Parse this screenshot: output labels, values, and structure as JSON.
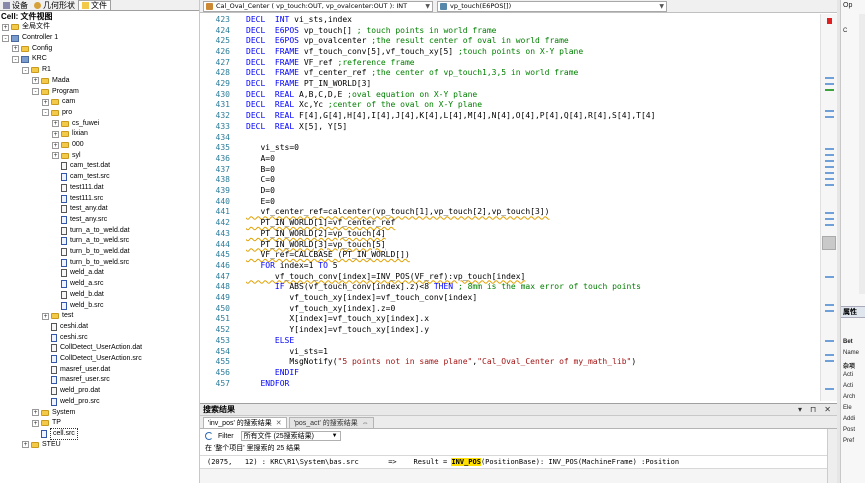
{
  "left_panel": {
    "tabs": [
      {
        "label": "设备",
        "icon": "device-icon"
      },
      {
        "label": "几何形状",
        "icon": "geometry-icon"
      },
      {
        "label": "文件",
        "icon": "file-icon"
      }
    ],
    "title": "Cell: 文件视图",
    "tree": [
      {
        "label": "全局文件",
        "depth": 0,
        "kind": "folder",
        "exp": "+"
      },
      {
        "label": "Controller 1",
        "depth": 0,
        "kind": "cfg",
        "exp": "-"
      },
      {
        "label": "Config",
        "depth": 1,
        "kind": "folder",
        "exp": "+"
      },
      {
        "label": "KRC",
        "depth": 1,
        "kind": "cfg",
        "exp": "-"
      },
      {
        "label": "R1",
        "depth": 2,
        "kind": "folder",
        "exp": "-"
      },
      {
        "label": "Mada",
        "depth": 3,
        "kind": "folder",
        "exp": "+"
      },
      {
        "label": "Program",
        "depth": 3,
        "kind": "folder",
        "exp": "-"
      },
      {
        "label": "cam",
        "depth": 4,
        "kind": "folder",
        "exp": "+"
      },
      {
        "label": "pro",
        "depth": 4,
        "kind": "folder",
        "exp": "-"
      },
      {
        "label": "cs_fuwei",
        "depth": 5,
        "kind": "folder",
        "exp": "+"
      },
      {
        "label": "lixian",
        "depth": 5,
        "kind": "folder",
        "exp": "+"
      },
      {
        "label": "000",
        "depth": 5,
        "kind": "folder",
        "exp": "+"
      },
      {
        "label": "syl",
        "depth": 5,
        "kind": "folder",
        "exp": "+"
      },
      {
        "label": "cam_test.dat",
        "depth": 5,
        "kind": "dat",
        "exp": ""
      },
      {
        "label": "cam_test.src",
        "depth": 5,
        "kind": "src",
        "exp": ""
      },
      {
        "label": "test111.dat",
        "depth": 5,
        "kind": "dat",
        "exp": ""
      },
      {
        "label": "test111.src",
        "depth": 5,
        "kind": "src",
        "exp": ""
      },
      {
        "label": "test_any.dat",
        "depth": 5,
        "kind": "dat",
        "exp": ""
      },
      {
        "label": "test_any.src",
        "depth": 5,
        "kind": "src",
        "exp": ""
      },
      {
        "label": "turn_a_to_weld.dat",
        "depth": 5,
        "kind": "dat",
        "exp": ""
      },
      {
        "label": "turn_a_to_weld.src",
        "depth": 5,
        "kind": "src",
        "exp": ""
      },
      {
        "label": "turn_b_to_weld.dat",
        "depth": 5,
        "kind": "dat",
        "exp": ""
      },
      {
        "label": "turn_b_to_weld.src",
        "depth": 5,
        "kind": "src",
        "exp": ""
      },
      {
        "label": "weld_a.dat",
        "depth": 5,
        "kind": "dat",
        "exp": ""
      },
      {
        "label": "weld_a.src",
        "depth": 5,
        "kind": "src",
        "exp": ""
      },
      {
        "label": "weld_b.dat",
        "depth": 5,
        "kind": "dat",
        "exp": ""
      },
      {
        "label": "weld_b.src",
        "depth": 5,
        "kind": "src",
        "exp": ""
      },
      {
        "label": "test",
        "depth": 4,
        "kind": "folder",
        "exp": "+"
      },
      {
        "label": "ceshi.dat",
        "depth": 4,
        "kind": "dat",
        "exp": ""
      },
      {
        "label": "ceshi.src",
        "depth": 4,
        "kind": "src",
        "exp": ""
      },
      {
        "label": "CollDetect_UserAction.dat",
        "depth": 4,
        "kind": "dat",
        "exp": ""
      },
      {
        "label": "CollDetect_UserAction.src",
        "depth": 4,
        "kind": "src",
        "exp": ""
      },
      {
        "label": "masref_user.dat",
        "depth": 4,
        "kind": "dat",
        "exp": ""
      },
      {
        "label": "masref_user.src",
        "depth": 4,
        "kind": "src",
        "exp": ""
      },
      {
        "label": "weld_pro.dat",
        "depth": 4,
        "kind": "dat",
        "exp": ""
      },
      {
        "label": "weld_pro.src",
        "depth": 4,
        "kind": "src",
        "exp": ""
      },
      {
        "label": "System",
        "depth": 3,
        "kind": "folder",
        "exp": "+"
      },
      {
        "label": "TP",
        "depth": 3,
        "kind": "folder",
        "exp": "+"
      },
      {
        "label": "cell.src",
        "depth": 3,
        "kind": "src",
        "exp": "",
        "selected": true
      },
      {
        "label": "STEU",
        "depth": 2,
        "kind": "folder",
        "exp": "+"
      }
    ]
  },
  "editor": {
    "combo_left": "Cal_Oval_Center ( vp_touch:OUT, vp_ovalcenter:OUT ): INT",
    "combo_right": "vp_touch(E6POS[])",
    "lines": [
      {
        "n": "423",
        "t": "DECL  INT vi_sts,index"
      },
      {
        "n": "424",
        "t": "DECL  E6POS vp_touch[] ; touch points in world frame"
      },
      {
        "n": "425",
        "t": "DECL  E6POS vp_ovalcenter ;the result center of oval in world frame"
      },
      {
        "n": "426",
        "t": "DECL  FRAME vf_touch_conv[5],vf_touch_xy[5] ;touch points on X-Y plane"
      },
      {
        "n": "427",
        "t": "DECL  FRAME VF_ref ;reference frame"
      },
      {
        "n": "428",
        "t": "DECL  FRAME vf_center_ref ;the center of vp_touch1,3,5 in world frame"
      },
      {
        "n": "429",
        "t": "DECL  FRAME PT_IN_WORLD[3]"
      },
      {
        "n": "430",
        "t": "DECL  REAL A,B,C,D,E ;oval equation on X-Y plane"
      },
      {
        "n": "431",
        "t": "DECL  REAL Xc,Yc ;center of the oval on X-Y plane"
      },
      {
        "n": "432",
        "t": "DECL  REAL F[4],G[4],H[4],I[4],J[4],K[4],L[4],M[4],N[4],O[4],P[4],Q[4],R[4],S[4],T[4]"
      },
      {
        "n": "433",
        "t": "DECL  REAL X[5], Y[5]"
      },
      {
        "n": "434",
        "t": ""
      },
      {
        "n": "435",
        "t": "   vi_sts=0"
      },
      {
        "n": "436",
        "t": "   A=0"
      },
      {
        "n": "437",
        "t": "   B=0"
      },
      {
        "n": "438",
        "t": "   C=0"
      },
      {
        "n": "439",
        "t": "   D=0"
      },
      {
        "n": "440",
        "t": "   E=0"
      },
      {
        "n": "441",
        "t": "   vf_center_ref=calcenter(vp_touch[1],vp_touch[2],vp_touch[3])"
      },
      {
        "n": "442",
        "t": "   PT_IN_WORLD[1]=vf_center_ref"
      },
      {
        "n": "443",
        "t": "   PT_IN_WORLD[2]=vp_touch[4]"
      },
      {
        "n": "444",
        "t": "   PT_IN_WORLD[3]=vp_touch[5]"
      },
      {
        "n": "445",
        "t": "   VF_ref=CALCBASE (PT_IN_WORLD[])"
      },
      {
        "n": "446",
        "t": "   FOR index=1 TO 5"
      },
      {
        "n": "447",
        "t": "      vf_touch_conv[index]=INV_POS(VF_ref):vp_touch[index]"
      },
      {
        "n": "448",
        "t": "      IF ABS(vf_touch_conv[index].z)<8 THEN ; 8mm is the max error of touch points"
      },
      {
        "n": "449",
        "t": "         vf_touch_xy[index]=vf_touch_conv[index]"
      },
      {
        "n": "450",
        "t": "         vf_touch_xy[index].z=0"
      },
      {
        "n": "451",
        "t": "         X[index]=vf_touch_xy[index].x"
      },
      {
        "n": "452",
        "t": "         Y[index]=vf_touch_xy[index].y"
      },
      {
        "n": "453",
        "t": "      ELSE"
      },
      {
        "n": "454",
        "t": "         vi_sts=1"
      },
      {
        "n": "455",
        "t": "         MsgNotify(\"5 points not in same plane\",\"Cal_Oval_Center of my_math_lib\")"
      },
      {
        "n": "456",
        "t": "      ENDIF"
      },
      {
        "n": "457",
        "t": "   ENDFOR"
      }
    ]
  },
  "search": {
    "title": "搜索结果",
    "header_buttons": [
      "▾",
      "⊓",
      "✕"
    ],
    "tabs": [
      {
        "label": "'inv_pos' 的搜索结果",
        "close": "✕",
        "active": true
      },
      {
        "label": "'pos_act' 的搜索结果",
        "close": "⇔",
        "active": false
      }
    ],
    "filter_label": "Filter",
    "filter_value": "所有文件 (25搜索结果)",
    "scope_text": "在 '整个项目' 里搜索的 25 结果",
    "result": {
      "prefix": "(2075,   12) : KRC\\R1\\System\\bas.src       =>    Result = ",
      "match": "INV_POS",
      "suffix": "(PositionBase): INV_POS(MachineFrame) :Position"
    }
  },
  "right_panel": {
    "top_text": "Op",
    "items": [
      "C",
      "属性",
      "Bet",
      "Name",
      "杂项",
      "Acti",
      "Acti",
      "Arch",
      "Ele",
      "Addi",
      "Post",
      "Pref"
    ]
  },
  "colors": {
    "keyword": "#0000ff",
    "comment": "#008000",
    "string": "#a31515",
    "line_number": "#2b7d9a",
    "highlight": "#ffe000"
  }
}
